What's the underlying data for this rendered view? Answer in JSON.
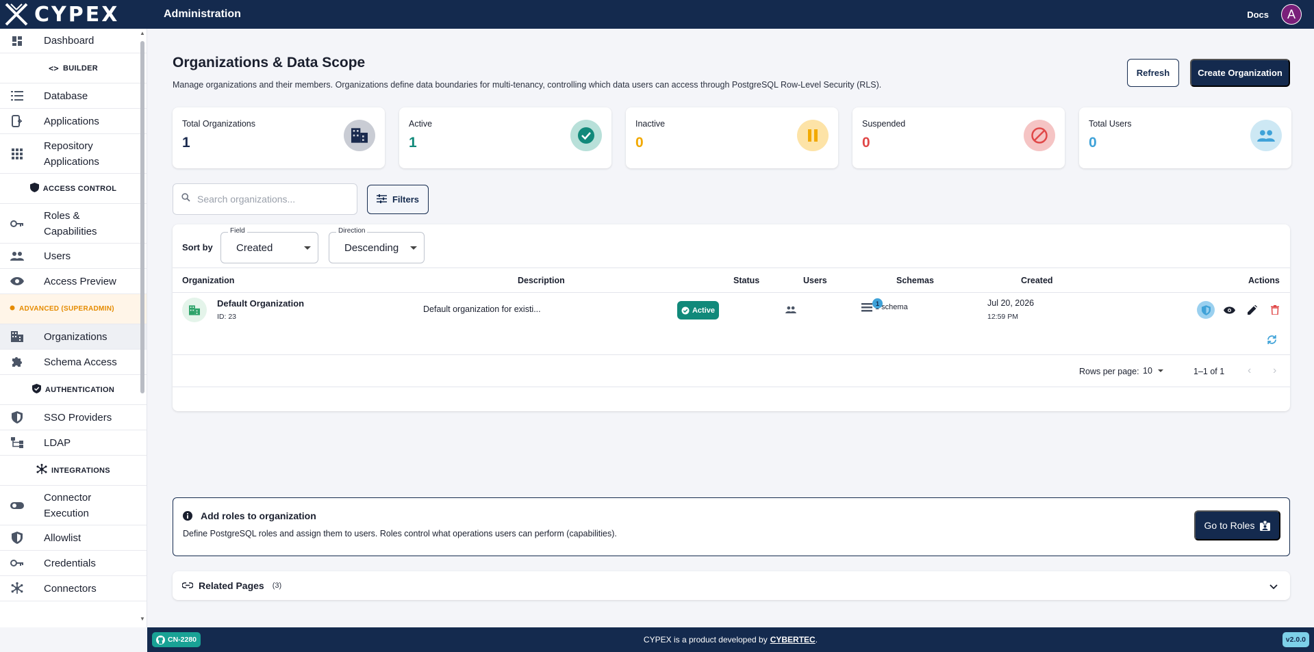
{
  "app": {
    "logo_text": "CYPEX",
    "section_title": "Administration",
    "docs_label": "Docs",
    "avatar_initial": "A"
  },
  "sidebar": {
    "dashboard": "Dashboard",
    "builder_section": "BUILDER",
    "database": "Database",
    "applications": "Applications",
    "repository_applications_1": "Repository",
    "repository_applications_2": "Applications",
    "access_control_section": "ACCESS CONTROL",
    "roles_1": "Roles &",
    "roles_2": "Capabilities",
    "users": "Users",
    "access_preview": "Access Preview",
    "advanced_section": "ADVANCED (SUPERADMIN)",
    "organizations": "Organizations",
    "schema_access": "Schema Access",
    "authentication_section": "AUTHENTICATION",
    "sso_providers": "SSO Providers",
    "ldap": "LDAP",
    "integrations_section": "INTEGRATIONS",
    "connector_execution_1": "Connector",
    "connector_execution_2": "Execution",
    "allowlist": "Allowlist",
    "credentials": "Credentials",
    "connectors": "Connectors"
  },
  "page": {
    "title": "Organizations & Data Scope",
    "description": "Manage organizations and their members. Organizations define data boundaries for multi-tenancy, controlling which data users can access through PostgreSQL Row-Level Security (RLS).",
    "refresh_label": "Refresh",
    "create_label": "Create Organization"
  },
  "stats": [
    {
      "label": "Total Organizations",
      "value": "1",
      "color": "#1a2a4e"
    },
    {
      "label": "Active",
      "value": "1",
      "color": "#11897a"
    },
    {
      "label": "Inactive",
      "value": "0",
      "color": "#f2a900"
    },
    {
      "label": "Suspended",
      "value": "0",
      "color": "#e04848"
    },
    {
      "label": "Total Users",
      "value": "0",
      "color": "#3fa2d8"
    }
  ],
  "search": {
    "placeholder": "Search organizations..."
  },
  "filters_label": "Filters",
  "sort": {
    "label": "Sort by",
    "field_legend": "Field",
    "field_value": "Created",
    "direction_legend": "Direction",
    "direction_value": "Descending"
  },
  "table": {
    "columns": [
      "Organization",
      "Description",
      "Status",
      "Users",
      "Schemas",
      "Created",
      "Actions"
    ],
    "rows": [
      {
        "name": "Default Organization",
        "id": "ID: 23",
        "description": "Default organization for existi...",
        "status": "Active",
        "schema_count_badge": "1",
        "schemas": "1 schema",
        "created_date": "Jul 20, 2026",
        "created_time": "12:59 PM"
      }
    ]
  },
  "pagination": {
    "rows_per_page_label": "Rows per page:",
    "rows_per_page": "10",
    "range": "1–1 of 1"
  },
  "info": {
    "title": "Add roles to organization",
    "description": "Define PostgreSQL roles and assign them to users. Roles control what operations users can perform (capabilities).",
    "button_label": "Go to Roles"
  },
  "related": {
    "title": "Related Pages",
    "count": "(3)"
  },
  "footer": {
    "build_badge": "CN-2280",
    "credits_prefix": "CYPEX is a product developed by",
    "brand": "CYBERTEC",
    "credits_suffix": ".",
    "version": "v2.0.0"
  }
}
